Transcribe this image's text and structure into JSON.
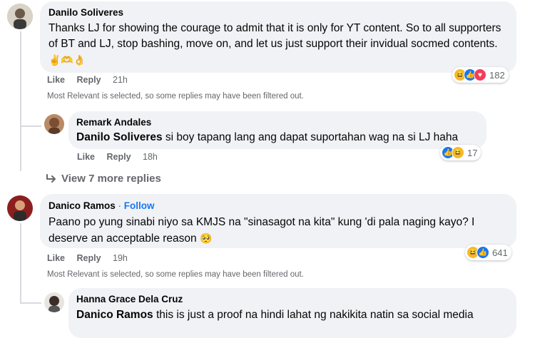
{
  "comments": [
    {
      "author": "Danilo Soliveres",
      "text": "Thanks LJ for showing the courage to admit that it is only for YT content. So to all supporters of BT and LJ, stop bashing, move on, and let us just support their invidual socmed contents.",
      "emojis": "✌️🫶👌",
      "like": "Like",
      "reply": "Reply",
      "time": "21h",
      "reaction_count": "182",
      "filter_note": "Most Relevant is selected, so some replies may have been filtered out."
    },
    {
      "author": "Remark Andales",
      "mention": "Danilo Soliveres",
      "text": " si boy tapang lang ang dapat suportahan wag na si LJ haha",
      "like": "Like",
      "reply": "Reply",
      "time": "18h",
      "reaction_count": "17"
    },
    {
      "view_more": "View 7 more replies"
    },
    {
      "author": "Danico Ramos",
      "follow": "Follow",
      "separator": " · ",
      "text": "Paano po yung sinabi niyo sa KMJS na \"sinasagot na kita\" kung 'di pala naging kayo? I deserve an acceptable reason",
      "emoji": "🥺",
      "like": "Like",
      "reply": "Reply",
      "time": "19h",
      "reaction_count": "641",
      "filter_note": "Most Relevant is selected, so some replies may have been filtered out."
    },
    {
      "author": "Hanna Grace Dela Cruz",
      "mention": "Danico Ramos",
      "text": " this is just a proof na hindi lahat ng nakikita natin sa social media"
    }
  ],
  "colors": {
    "bubble": "#f0f2f5",
    "secondary_text": "#65676b",
    "link_blue": "#1877f2",
    "haha": "#f7b928",
    "like": "#1877f2",
    "love": "#f33e58"
  },
  "icons": {
    "reply_arrow": "arrow-turn-icon",
    "reactions": [
      "haha-reaction-icon",
      "like-reaction-icon",
      "love-reaction-icon"
    ]
  }
}
